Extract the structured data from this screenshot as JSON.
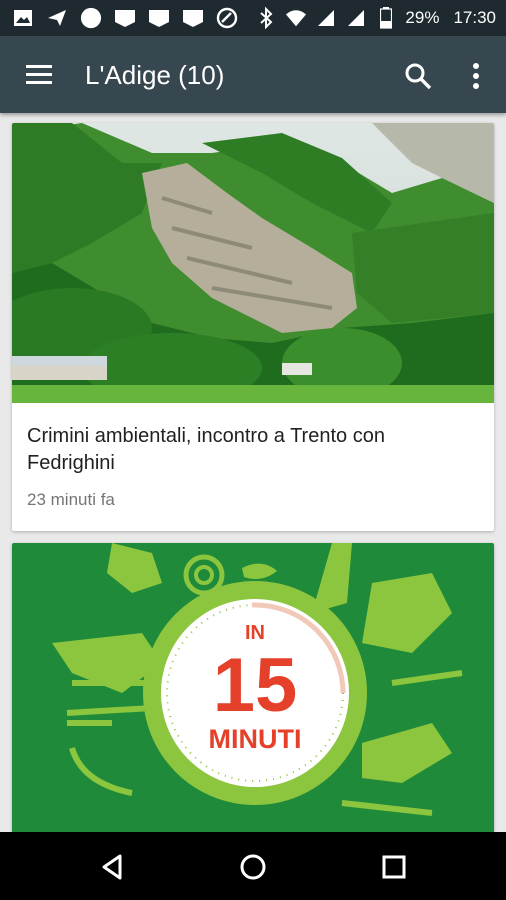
{
  "status_bar": {
    "battery_percent": "29%",
    "time": "17:30",
    "left_icons": [
      "image-icon",
      "navigation-icon",
      "circle-icon",
      "notification-icon",
      "notification-icon",
      "notification-icon",
      "data-saver-icon"
    ],
    "right_icons": [
      "bluetooth-icon",
      "wifi-icon",
      "signal-icon",
      "signal-icon",
      "battery-icon"
    ]
  },
  "app_bar": {
    "title": "L'Adige (10)",
    "menu_icon": "hamburger-menu-icon",
    "search_icon": "search-icon",
    "more_icon": "more-vert-icon",
    "color": "#37474f"
  },
  "articles": [
    {
      "title": "Crimini ambientali, incontro  a Trento con Fedrighini",
      "time": "23 minuti fa",
      "image": "quarry-mountain-photo"
    },
    {
      "image": "in-15-minuti-illustration",
      "image_text": {
        "line1": "IN",
        "number": "15",
        "word": "MINUTI"
      }
    }
  ],
  "nav_bar": {
    "back": "back-icon",
    "home": "home-icon",
    "recents": "recents-icon"
  },
  "colors": {
    "accent_green": "#1e8a3a",
    "lime": "#8cc63f",
    "headline_red": "#e4402a"
  }
}
